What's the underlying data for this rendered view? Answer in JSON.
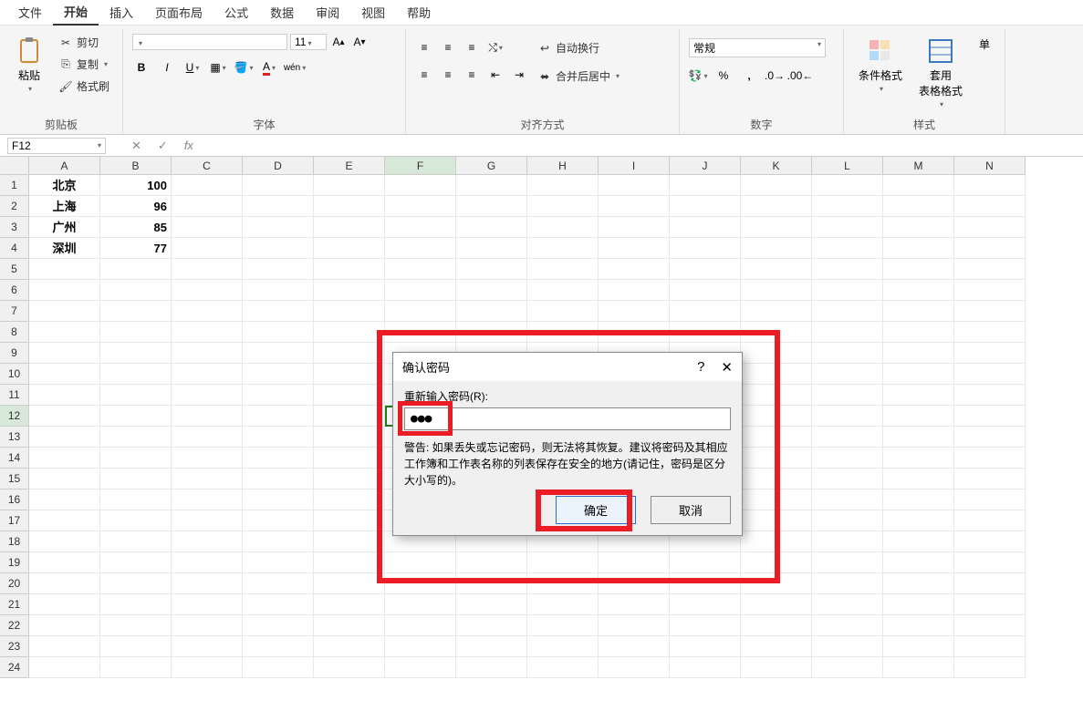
{
  "menu": {
    "items": [
      "文件",
      "开始",
      "插入",
      "页面布局",
      "公式",
      "数据",
      "审阅",
      "视图",
      "帮助"
    ],
    "active_index": 1
  },
  "ribbon": {
    "clipboard": {
      "paste": "粘贴",
      "cut": "剪切",
      "copy": "复制",
      "format_painter": "格式刷",
      "label": "剪贴板"
    },
    "font": {
      "font_name": "",
      "font_size": "11",
      "label": "字体"
    },
    "align": {
      "wrap": "自动换行",
      "merge": "合并后居中",
      "label": "对齐方式"
    },
    "number": {
      "format": "常规",
      "label": "数字"
    },
    "styles": {
      "cond_fmt": "条件格式",
      "table_fmt": "套用\n表格格式",
      "cell_style": "单",
      "label": "样式"
    }
  },
  "formula_bar": {
    "name_box": "F12",
    "fx_label": "fx",
    "formula": ""
  },
  "grid": {
    "columns": [
      "A",
      "B",
      "C",
      "D",
      "E",
      "F",
      "G",
      "H",
      "I",
      "J",
      "K",
      "L",
      "M",
      "N"
    ],
    "rows": 24,
    "selected_col": "F",
    "selected_row": 12,
    "data": [
      {
        "r": 1,
        "A": "北京",
        "B": "100"
      },
      {
        "r": 2,
        "A": "上海",
        "B": "96"
      },
      {
        "r": 3,
        "A": "广州",
        "B": "85"
      },
      {
        "r": 4,
        "A": "深圳",
        "B": "77"
      }
    ]
  },
  "dialog": {
    "title": "确认密码",
    "label": "重新输入密码(R):",
    "password_mask": "●●●",
    "warning": "警告: 如果丢失或忘记密码，则无法将其恢复。建议将密码及其相应工作簿和工作表名称的列表保存在安全的地方(请记住，密码是区分大小写的)。",
    "ok": "确定",
    "cancel": "取消",
    "help": "?",
    "close": "✕"
  }
}
